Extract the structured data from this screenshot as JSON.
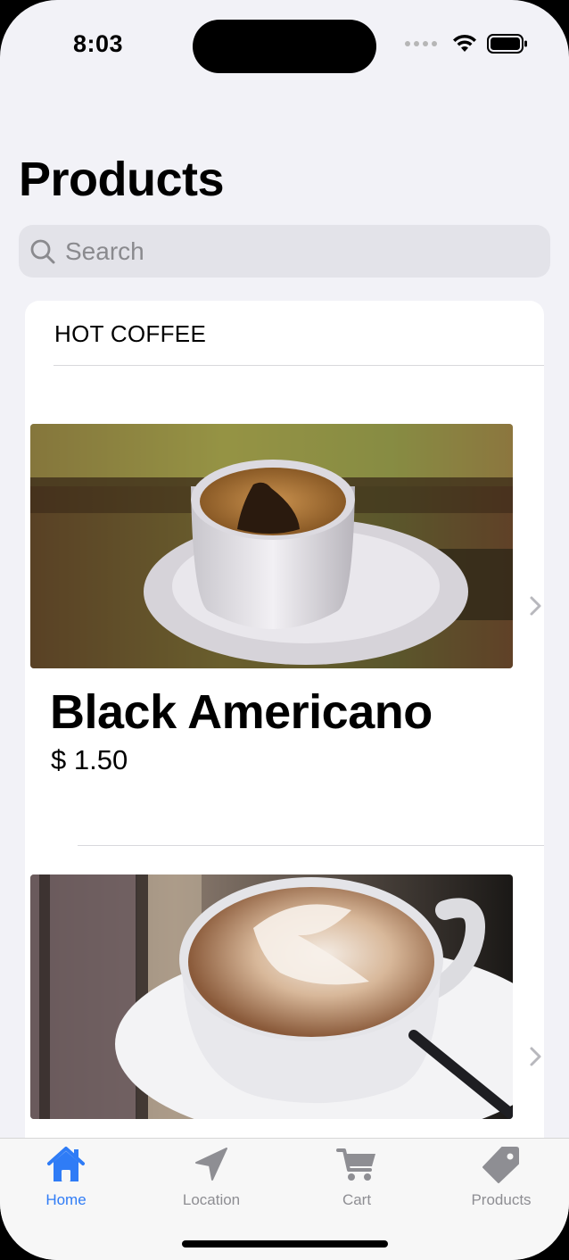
{
  "status_bar": {
    "time": "8:03",
    "icons": [
      "signal-dots-icon",
      "wifi-icon",
      "battery-icon"
    ]
  },
  "header": {
    "title": "Products"
  },
  "search": {
    "placeholder": "Search",
    "value": "",
    "icon": "search-icon"
  },
  "section": {
    "header": "HOT COFFEE",
    "products": [
      {
        "name": "Black Americano",
        "price": "$ 1.50",
        "image": "coffee-cup-photo"
      },
      {
        "name": "",
        "price": "",
        "image": "latte-art-photo"
      }
    ]
  },
  "tab_bar": {
    "active_color": "#2f7cf6",
    "inactive_color": "#8e8e93",
    "tabs": [
      {
        "label": "Home",
        "icon": "house-icon",
        "active": true
      },
      {
        "label": "Location",
        "icon": "location-arrow-icon",
        "active": false
      },
      {
        "label": "Cart",
        "icon": "cart-icon",
        "active": false
      },
      {
        "label": "Products",
        "icon": "tag-icon",
        "active": false
      }
    ]
  }
}
